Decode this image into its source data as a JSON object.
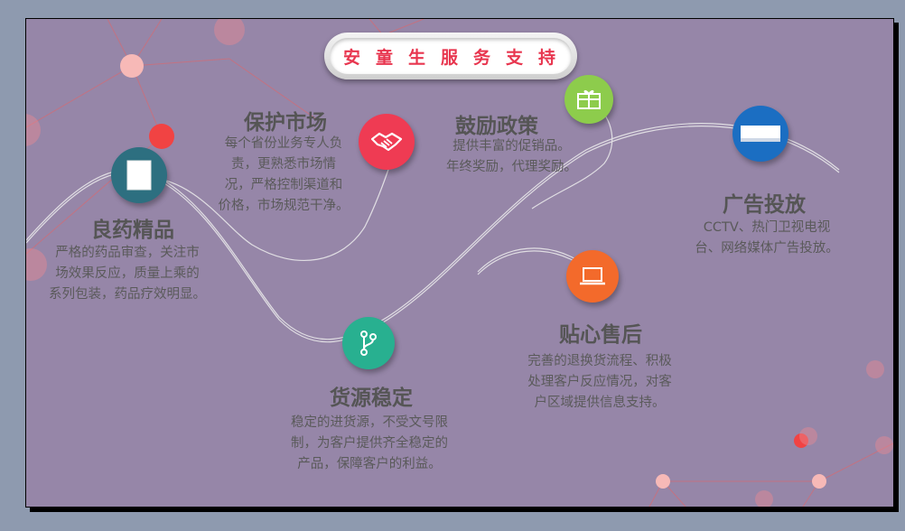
{
  "title": "安童生服务支持",
  "features": [
    {
      "key": "quality",
      "heading": "良药精品",
      "lines": [
        "严格的药品审查，关注市",
        "场效果反应，质量上乘的",
        "系列包装，药品疗效明显。"
      ],
      "icon": "document-icon",
      "color": "#2d6f80"
    },
    {
      "key": "market",
      "heading": "保护市场",
      "lines": [
        "每个省份业务专人负",
        "责，更熟悉市场情",
        "况，严格控制渠道和",
        "价格，市场规范干净。"
      ],
      "icon": "handshake-icon",
      "color": "#ef3b53"
    },
    {
      "key": "supply",
      "heading": "货源稳定",
      "lines": [
        "稳定的进货源，不受文号限",
        "制，为客户提供齐全稳定的",
        "产品，保障客户的利益。"
      ],
      "icon": "branch-icon",
      "color": "#28b090"
    },
    {
      "key": "policy",
      "heading": "鼓励政策",
      "lines": [
        "提供丰富的促销品。",
        "年终奖励，代理奖励。"
      ],
      "icon": "gift-icon",
      "color": "#8dcc4c"
    },
    {
      "key": "aftersale",
      "heading": "贴心售后",
      "lines": [
        "完善的退换货流程、积极",
        "处理客户反应情况，对客",
        "户区域提供信息支持。"
      ],
      "icon": "laptop-icon",
      "color": "#f36a2b"
    },
    {
      "key": "ads",
      "heading": "广告投放",
      "lines": [
        "CCTV、热门卫视电视",
        "台、网络媒体广告投放。"
      ],
      "icon": "card-icon",
      "color": "#1b6ec2"
    }
  ]
}
